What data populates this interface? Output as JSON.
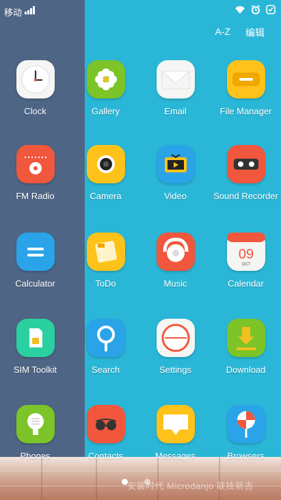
{
  "status_bar": {
    "carrier": "移动"
  },
  "top_bar": {
    "sort_label": "A-Z",
    "edit_label": "编辑"
  },
  "apps": [
    {
      "label": "Clock",
      "icon": "clock-icon",
      "color": "#f5f5f3"
    },
    {
      "label": "Gallery",
      "icon": "gallery-icon",
      "color": "#7cc427"
    },
    {
      "label": "Email",
      "icon": "email-icon",
      "color": "#f5f5f3"
    },
    {
      "label": "File Manager",
      "icon": "folder-icon",
      "color": "#ffc21a"
    },
    {
      "label": "FM Radio",
      "icon": "radio-icon",
      "color": "#f0573d"
    },
    {
      "label": "Camera",
      "icon": "camera-icon",
      "color": "#ffc21a"
    },
    {
      "label": "Video",
      "icon": "video-icon",
      "color": "#2aa3e8"
    },
    {
      "label": "Sound Recorder",
      "icon": "recorder-icon",
      "color": "#f0573d"
    },
    {
      "label": "Calculator",
      "icon": "calculator-icon",
      "color": "#2aa3e8"
    },
    {
      "label": "ToDo",
      "icon": "todo-icon",
      "color": "#ffc21a"
    },
    {
      "label": "Music",
      "icon": "music-icon",
      "color": "#f0573d"
    },
    {
      "label": "Calendar",
      "icon": "calendar-icon",
      "color": "#f5f5f3",
      "date": "09",
      "month": "OCT"
    },
    {
      "label": "SIM Toolkit",
      "icon": "sim-icon",
      "color": "#2ad0a0"
    },
    {
      "label": "Search",
      "icon": "search-icon",
      "color": "#2aa3e8"
    },
    {
      "label": "Settings",
      "icon": "settings-icon",
      "color": "#f5f5f3"
    },
    {
      "label": "Download",
      "icon": "download-icon",
      "color": "#7cc427"
    },
    {
      "label": "Phones",
      "icon": "phone-icon",
      "color": "#7cc427"
    },
    {
      "label": "Contacts",
      "icon": "contacts-icon",
      "color": "#f0573d"
    },
    {
      "label": "Messages",
      "icon": "messages-icon",
      "color": "#ffc21a"
    },
    {
      "label": "Browsers",
      "icon": "browser-icon",
      "color": "#2aa3e8"
    }
  ],
  "pager": {
    "pages": 2,
    "active": 1
  },
  "watermark": "安装时代 Microdanjo 联技新吉"
}
